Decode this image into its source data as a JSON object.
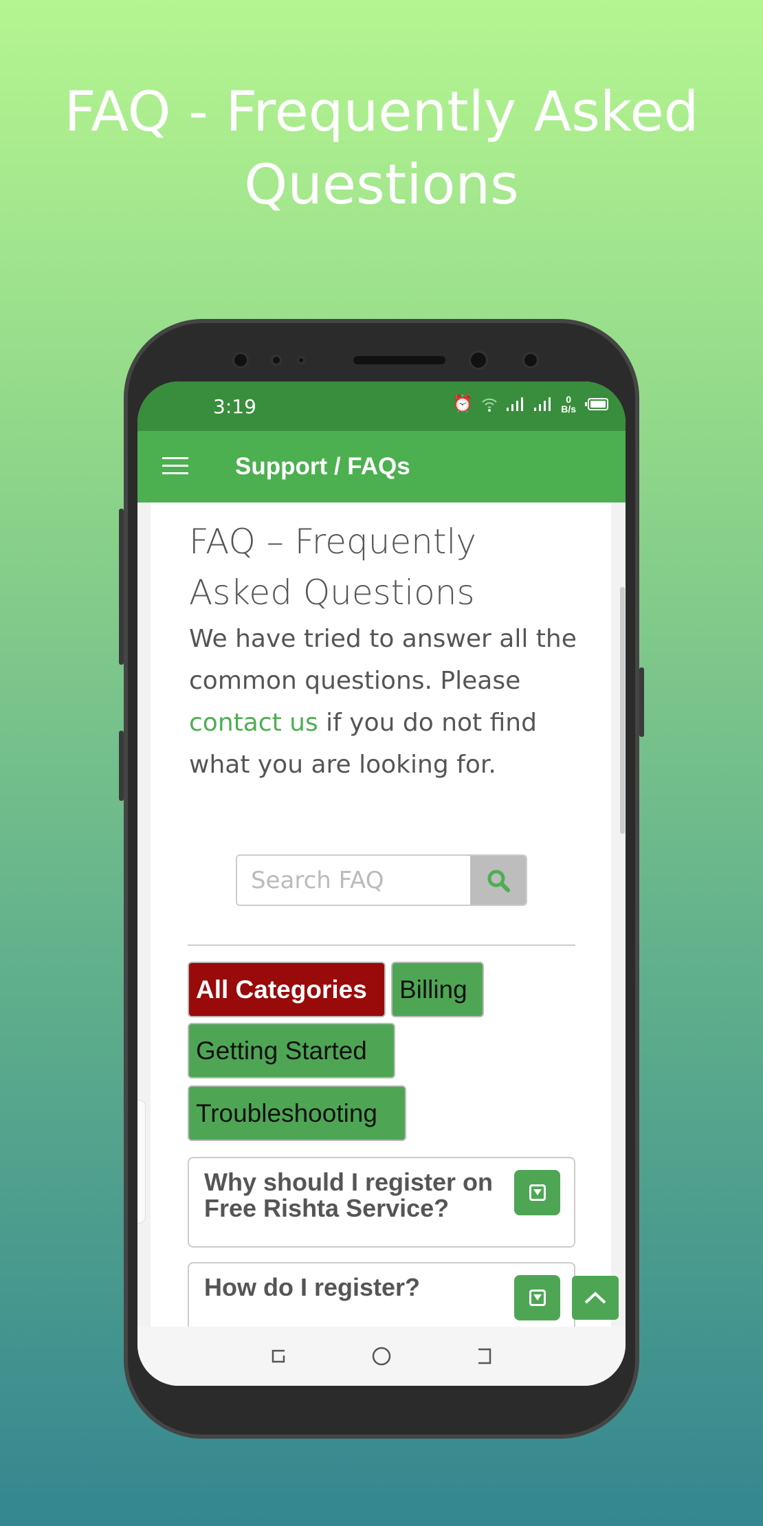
{
  "headline": {
    "line1": "FAQ - Frequently Asked",
    "line2": "Questions"
  },
  "status_bar": {
    "time": "3:19",
    "net_speed_value": "0",
    "net_speed_unit": "B/s",
    "icons": [
      "alarm-icon",
      "wifi-icon",
      "signal-icon",
      "signal-icon",
      "battery-icon"
    ]
  },
  "app_bar": {
    "title": "Support / FAQs",
    "menu_icon": "hamburger-icon"
  },
  "content": {
    "title": "FAQ – Frequently Asked Questions",
    "intro_before": "We have tried to answer all the common questions. Please ",
    "intro_link": "contact us",
    "intro_after": " if you do not find what you are looking for.",
    "search": {
      "placeholder": "Search FAQ",
      "value": "",
      "button_icon": "search-icon"
    },
    "categories": [
      {
        "label": "All Categories",
        "active": true
      },
      {
        "label": "Billing",
        "active": false
      },
      {
        "label": "Getting Started",
        "active": false
      },
      {
        "label": "Troubleshooting",
        "active": false
      }
    ],
    "faqs": [
      {
        "question": "Why should I register on Free Rishta Service?"
      },
      {
        "question": "How do I register?"
      }
    ]
  },
  "colors": {
    "status_bar": "#388e3c",
    "app_bar": "#4caf50",
    "chip": "#4ea654",
    "chip_active": "#990a0a",
    "link": "#4caf50"
  }
}
